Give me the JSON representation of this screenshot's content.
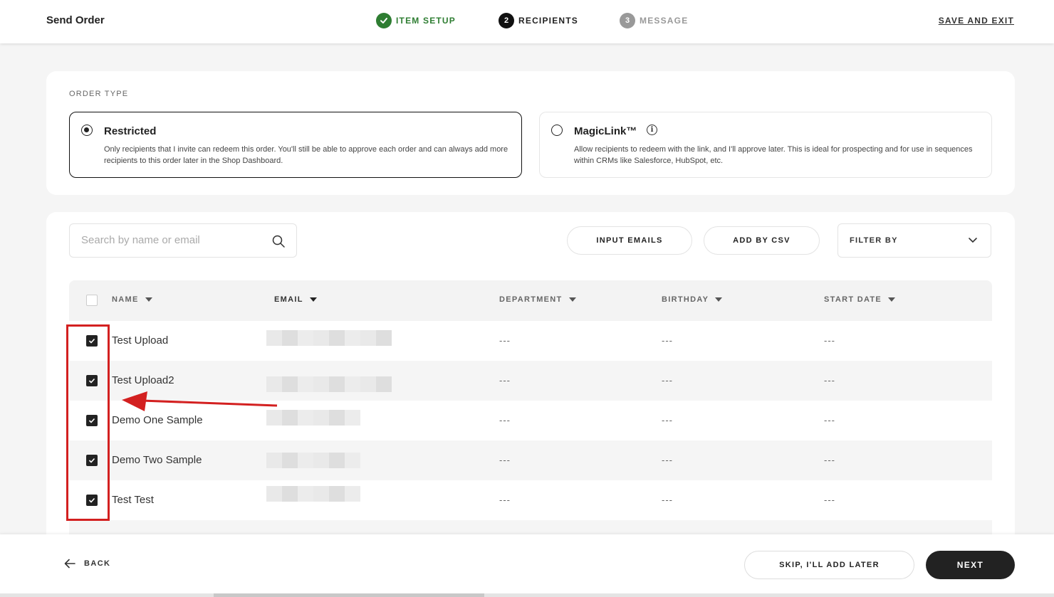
{
  "header": {
    "title": "Send Order",
    "save_exit": "SAVE AND EXIT",
    "steps": [
      {
        "num": "",
        "label": "ITEM SETUP",
        "state": "done"
      },
      {
        "num": "2",
        "label": "RECIPIENTS",
        "state": "active"
      },
      {
        "num": "3",
        "label": "MESSAGE",
        "state": "pending"
      }
    ]
  },
  "order_type": {
    "label": "ORDER TYPE",
    "options": [
      {
        "title": "Restricted",
        "selected": true,
        "desc": "Only recipients that I invite can redeem this order. You'll still be able to approve each order and can always add more recipients to this order later in the Shop Dashboard."
      },
      {
        "title": "MagicLink™",
        "selected": false,
        "desc": "Allow recipients to redeem with the link, and I'll approve later. This is ideal for prospecting and for use in sequences within CRMs like Salesforce, HubSpot, etc."
      }
    ]
  },
  "recipients": {
    "search_placeholder": "Search by name or email",
    "input_emails": "INPUT EMAILS",
    "add_by_csv": "ADD BY CSV",
    "filter_by": "FILTER BY",
    "columns": [
      "NAME",
      "EMAIL",
      "DEPARTMENT",
      "BIRTHDAY",
      "START DATE"
    ],
    "rows": [
      {
        "name": "Test Upload",
        "department": "---",
        "birthday": "---",
        "start_date": "---",
        "checked": true
      },
      {
        "name": "Test Upload2",
        "department": "---",
        "birthday": "---",
        "start_date": "---",
        "checked": true
      },
      {
        "name": "Demo One Sample",
        "department": "---",
        "birthday": "---",
        "start_date": "---",
        "checked": true
      },
      {
        "name": "Demo Two Sample",
        "department": "---",
        "birthday": "---",
        "start_date": "---",
        "checked": true
      },
      {
        "name": "Test Test",
        "department": "---",
        "birthday": "---",
        "start_date": "---",
        "checked": true
      }
    ]
  },
  "footer": {
    "back": "BACK",
    "skip": "SKIP, I'LL ADD LATER",
    "next": "NEXT"
  },
  "colors": {
    "done_green": "#2e7d32",
    "annotation_red": "#d32020",
    "primary_dark": "#222222"
  }
}
